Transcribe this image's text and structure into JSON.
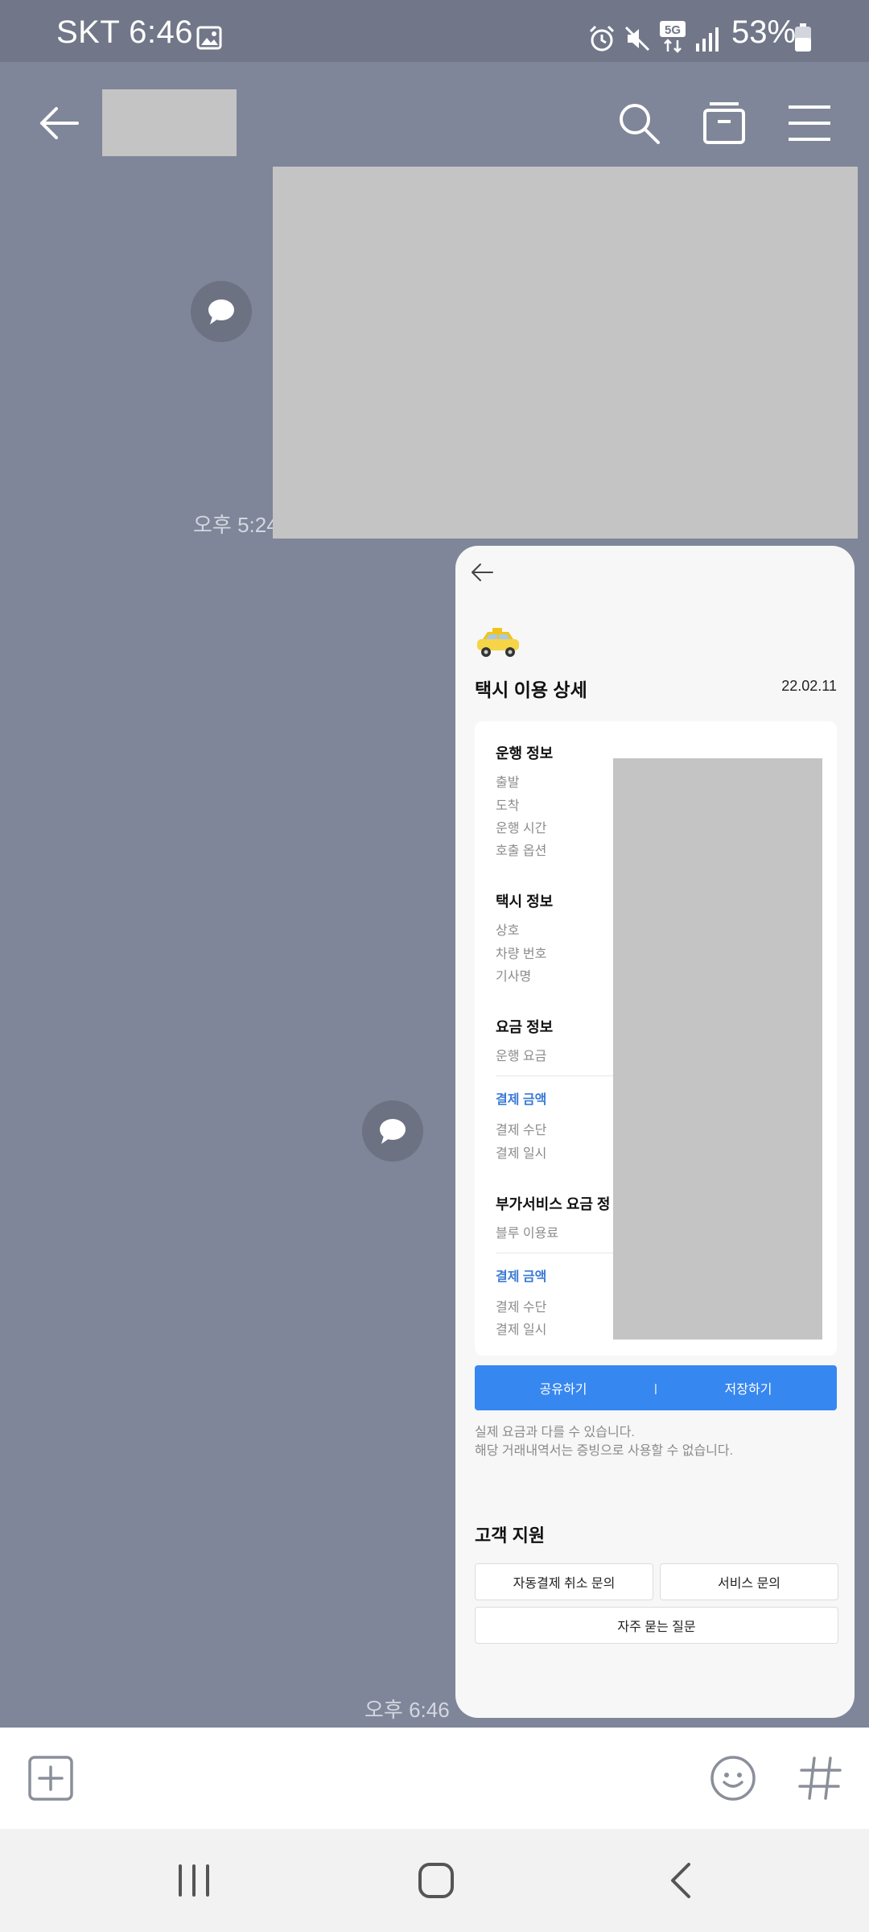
{
  "status_bar": {
    "carrier_time": "SKT 6:46",
    "battery": "53%",
    "icons": [
      "image-icon",
      "alarm-icon",
      "mute-icon",
      "5g-icon",
      "signal-icon",
      "battery-icon"
    ]
  },
  "app_bar": {
    "icons": [
      "back-arrow-icon",
      "search-icon",
      "drawer-icon",
      "menu-icon"
    ]
  },
  "messages": [
    {
      "time": "오후 5:24"
    },
    {
      "time": "오후 6:46"
    }
  ],
  "card": {
    "title": "택시 이용 상세",
    "date": "22.02.11",
    "sections": {
      "drive": {
        "title": "운행 정보",
        "rows": [
          "출발",
          "도착",
          "운행 시간",
          "호출 옵션"
        ]
      },
      "taxi": {
        "title": "택시 정보",
        "rows": [
          "상호",
          "차량 번호",
          "기사명"
        ]
      },
      "fare": {
        "title": "요금 정보",
        "row": "운행 요금",
        "pay_amount": "결제 금액",
        "rows": [
          "결제 수단",
          "결제 일시"
        ]
      },
      "extra": {
        "title": "부가서비스 요금 정",
        "row": "블루 이용료",
        "pay_amount": "결제 금액",
        "rows": [
          "결제 수단",
          "결제 일시"
        ]
      }
    },
    "share_label": "공유하기",
    "separator": "|",
    "save_label": "저장하기",
    "disclaimer": [
      "실제 요금과 다를 수 있습니다.",
      "해당 거래내역서는 증빙으로 사용할 수 없습니다."
    ],
    "support": {
      "title": "고객 지원",
      "auto_pay_cancel": "자동결제 취소 문의",
      "service": "서비스 문의",
      "faq": "자주 묻는 질문"
    }
  },
  "input_bar": {
    "icons": [
      "add-icon",
      "emoji-icon",
      "hashtag-icon"
    ]
  },
  "nav_bar": {
    "icons": [
      "recent-apps-icon",
      "home-icon",
      "back-icon"
    ]
  }
}
